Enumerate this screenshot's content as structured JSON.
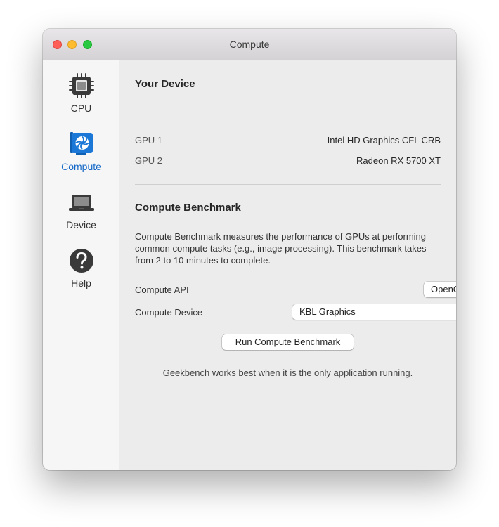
{
  "window": {
    "title": "Compute"
  },
  "sidebar": {
    "items": [
      {
        "label": "CPU",
        "icon": "cpu-chip-icon",
        "active": false
      },
      {
        "label": "Compute",
        "icon": "gpu-card-icon",
        "active": true
      },
      {
        "label": "Device",
        "icon": "laptop-icon",
        "active": false
      },
      {
        "label": "Help",
        "icon": "question-mark-icon",
        "active": false
      }
    ]
  },
  "device": {
    "heading": "Your Device",
    "gpus": [
      {
        "label": "GPU 1",
        "value": "Intel HD Graphics CFL CRB"
      },
      {
        "label": "GPU 2",
        "value": "Radeon RX 5700 XT"
      }
    ]
  },
  "benchmark": {
    "heading": "Compute Benchmark",
    "description": "Compute Benchmark measures the performance of GPUs at performing common compute tasks (e.g., image processing). This benchmark takes from 2 to 10 minutes to complete.",
    "api_label": "Compute API",
    "api_value": "OpenCL",
    "device_label": "Compute Device",
    "device_value": "KBL Graphics",
    "run_button": "Run Compute Benchmark",
    "footnote": "Geekbench works best when it is the only application running."
  },
  "colors": {
    "accent": "#1468c7",
    "popup_arrow": "#2a7ff0",
    "close": "#fe5f57",
    "minimize": "#febc2e",
    "maximize": "#28c840"
  }
}
